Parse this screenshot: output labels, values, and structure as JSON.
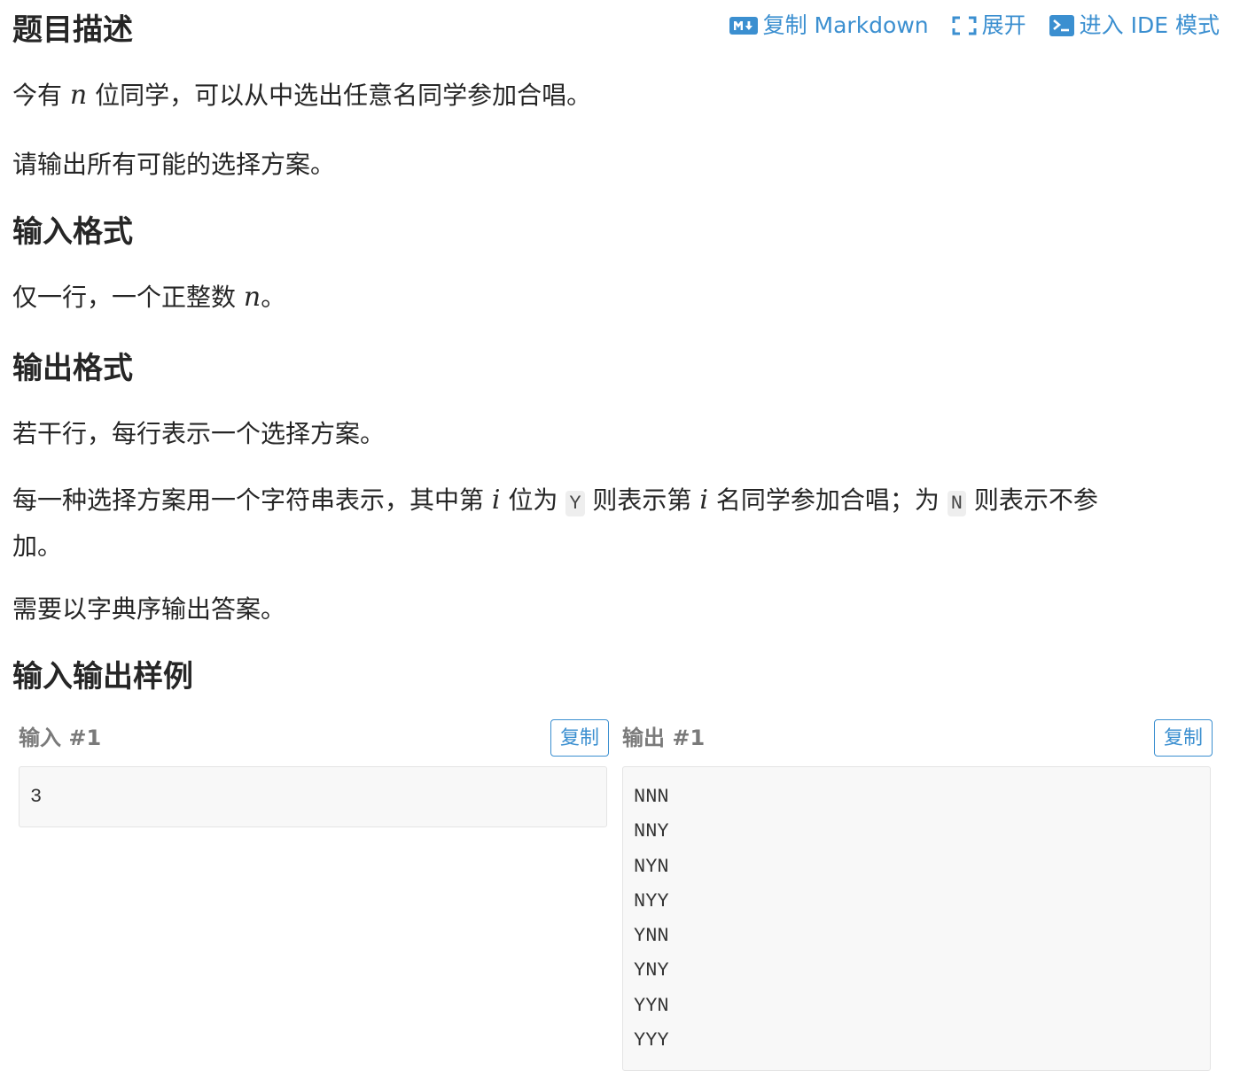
{
  "header": {
    "title": "题目描述",
    "actions": {
      "copy_markdown": "复制 Markdown",
      "expand": "展开",
      "ide": "进入 IDE 模式"
    }
  },
  "description": {
    "line1_a": "今有 ",
    "var_n": "n",
    "line1_b": " 位同学，可以从中选出任意名同学参加合唱。",
    "line2": "请输出所有可能的选择方案。"
  },
  "input_format": {
    "title": "输入格式",
    "text_a": "仅一行，一个正整数 ",
    "var_n": "n",
    "text_b": "。"
  },
  "output_format": {
    "title": "输出格式",
    "line1": "若干行，每行表示一个选择方案。",
    "line2_a": "每一种选择方案用一个字符串表示，其中第 ",
    "var_i": "i",
    "line2_b": " 位为 ",
    "code_y": "Y",
    "line2_c": " 则表示第 ",
    "line2_d": " 名同学参加合唱；为 ",
    "code_n": "N",
    "line2_e": " 则表示不参",
    "line2_f": "加。",
    "line3": "需要以字典序输出答案。"
  },
  "samples": {
    "title": "输入输出样例",
    "input": {
      "label": "输入 #1",
      "copy": "复制",
      "content": "3"
    },
    "output": {
      "label": "输出 #1",
      "copy": "复制",
      "content": "NNN\nNNY\nNYN\nNYY\nYNN\nYNY\nYYN\nYYY"
    }
  },
  "colors": {
    "accent": "#3b8fd0",
    "text": "#262626",
    "muted": "#7a7a7a",
    "code_bg": "#f8f8f8"
  }
}
